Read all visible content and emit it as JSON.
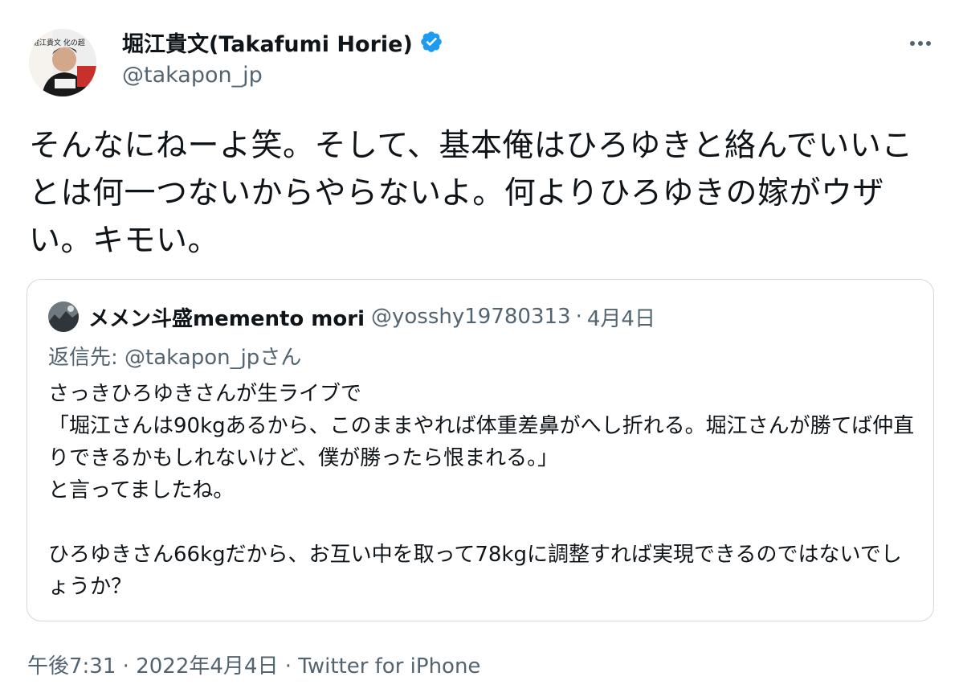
{
  "author": {
    "display_name": "堀江貴文(Takafumi Horie)",
    "handle": "@takapon_jp",
    "verified": true
  },
  "avatar_cover_text": "堀江貴文 化の超",
  "tweet": {
    "text": "そんなにねーよ笑。そして、基本俺はひろゆきと絡んでいいことは何一つないからやらないよ。何よりひろゆきの嫁がウザい。キモい。"
  },
  "quoted_tweet": {
    "display_name": "メメン斗盛memento mori",
    "handle": "@yosshy19780313",
    "separator": "·",
    "date": "4月4日",
    "reply_prefix": "返信先: ",
    "reply_to": "@takapon_jp",
    "reply_suffix": "さん",
    "body": "さっきひろゆきさんが生ライブで\n「堀江さんは90kgあるから、このままやれば体重差鼻がへし折れる。堀江さんが勝てば仲直りできるかもしれないけど、僕が勝ったら恨まれる。」\nと言ってましたね。\n\nひろゆきさん66kgだから、お互い中を取って78kgに調整すれば実現できるのではないでしょうか？"
  },
  "footer": {
    "time": "午後7:31",
    "separator": " · ",
    "date": "2022年4月4日",
    "source": "Twitter for iPhone"
  },
  "icons": {
    "verified": "verified-badge-icon",
    "more": "more-horizontal-icon"
  },
  "colors": {
    "verified_blue": "#1d9bf0",
    "secondary_text": "#536471",
    "border": "#cfd9de"
  }
}
